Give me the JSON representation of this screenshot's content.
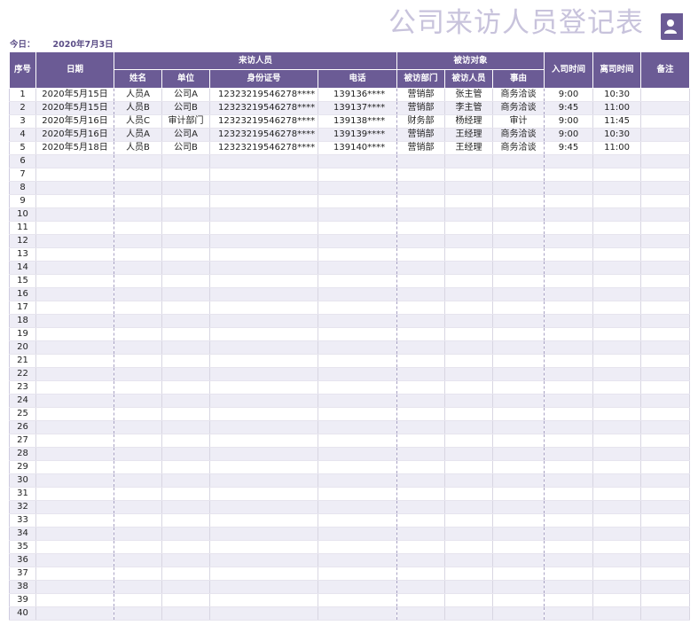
{
  "title": "公司来访人员登记表",
  "today_label": "今日：",
  "today_value": "2020年7月3日",
  "headers": {
    "seq": "序号",
    "date": "日期",
    "visitor_group": "来访人员",
    "name": "姓名",
    "unit": "单位",
    "id_no": "身份证号",
    "phone": "电话",
    "target_group": "被访对象",
    "dept": "被访部门",
    "person": "被访人员",
    "reason": "事由",
    "time_in": "入司时间",
    "time_out": "离司时间",
    "remark": "备注"
  },
  "rows": [
    [
      "1",
      "2020年5月15日",
      "人员A",
      "公司A",
      "12323219546278****",
      "139136****",
      "营销部",
      "张主管",
      "商务洽谈",
      "9:00",
      "10:30",
      ""
    ],
    [
      "2",
      "2020年5月15日",
      "人员B",
      "公司B",
      "12323219546278****",
      "139137****",
      "营销部",
      "李主管",
      "商务洽谈",
      "9:45",
      "11:00",
      ""
    ],
    [
      "3",
      "2020年5月16日",
      "人员C",
      "审计部门",
      "12323219546278****",
      "139138****",
      "财务部",
      "杨经理",
      "审计",
      "9:00",
      "11:45",
      ""
    ],
    [
      "4",
      "2020年5月16日",
      "人员A",
      "公司A",
      "12323219546278****",
      "139139****",
      "营销部",
      "王经理",
      "商务洽谈",
      "9:00",
      "10:30",
      ""
    ],
    [
      "5",
      "2020年5月18日",
      "人员B",
      "公司B",
      "12323219546278****",
      "139140****",
      "营销部",
      "王经理",
      "商务洽谈",
      "9:45",
      "11:00",
      ""
    ],
    [
      "6",
      "",
      "",
      "",
      "",
      "",
      "",
      "",
      "",
      "",
      "",
      ""
    ],
    [
      "7",
      "",
      "",
      "",
      "",
      "",
      "",
      "",
      "",
      "",
      "",
      ""
    ],
    [
      "8",
      "",
      "",
      "",
      "",
      "",
      "",
      "",
      "",
      "",
      "",
      ""
    ],
    [
      "9",
      "",
      "",
      "",
      "",
      "",
      "",
      "",
      "",
      "",
      "",
      ""
    ],
    [
      "10",
      "",
      "",
      "",
      "",
      "",
      "",
      "",
      "",
      "",
      "",
      ""
    ],
    [
      "11",
      "",
      "",
      "",
      "",
      "",
      "",
      "",
      "",
      "",
      "",
      ""
    ],
    [
      "12",
      "",
      "",
      "",
      "",
      "",
      "",
      "",
      "",
      "",
      "",
      ""
    ],
    [
      "13",
      "",
      "",
      "",
      "",
      "",
      "",
      "",
      "",
      "",
      "",
      ""
    ],
    [
      "14",
      "",
      "",
      "",
      "",
      "",
      "",
      "",
      "",
      "",
      "",
      ""
    ],
    [
      "15",
      "",
      "",
      "",
      "",
      "",
      "",
      "",
      "",
      "",
      "",
      ""
    ],
    [
      "16",
      "",
      "",
      "",
      "",
      "",
      "",
      "",
      "",
      "",
      "",
      ""
    ],
    [
      "17",
      "",
      "",
      "",
      "",
      "",
      "",
      "",
      "",
      "",
      "",
      ""
    ],
    [
      "18",
      "",
      "",
      "",
      "",
      "",
      "",
      "",
      "",
      "",
      "",
      ""
    ],
    [
      "19",
      "",
      "",
      "",
      "",
      "",
      "",
      "",
      "",
      "",
      "",
      ""
    ],
    [
      "20",
      "",
      "",
      "",
      "",
      "",
      "",
      "",
      "",
      "",
      "",
      ""
    ],
    [
      "21",
      "",
      "",
      "",
      "",
      "",
      "",
      "",
      "",
      "",
      "",
      ""
    ],
    [
      "22",
      "",
      "",
      "",
      "",
      "",
      "",
      "",
      "",
      "",
      "",
      ""
    ],
    [
      "23",
      "",
      "",
      "",
      "",
      "",
      "",
      "",
      "",
      "",
      "",
      ""
    ],
    [
      "24",
      "",
      "",
      "",
      "",
      "",
      "",
      "",
      "",
      "",
      "",
      ""
    ],
    [
      "25",
      "",
      "",
      "",
      "",
      "",
      "",
      "",
      "",
      "",
      "",
      ""
    ],
    [
      "26",
      "",
      "",
      "",
      "",
      "",
      "",
      "",
      "",
      "",
      "",
      ""
    ],
    [
      "27",
      "",
      "",
      "",
      "",
      "",
      "",
      "",
      "",
      "",
      "",
      ""
    ],
    [
      "28",
      "",
      "",
      "",
      "",
      "",
      "",
      "",
      "",
      "",
      "",
      ""
    ],
    [
      "29",
      "",
      "",
      "",
      "",
      "",
      "",
      "",
      "",
      "",
      "",
      ""
    ],
    [
      "30",
      "",
      "",
      "",
      "",
      "",
      "",
      "",
      "",
      "",
      "",
      ""
    ],
    [
      "31",
      "",
      "",
      "",
      "",
      "",
      "",
      "",
      "",
      "",
      "",
      ""
    ],
    [
      "32",
      "",
      "",
      "",
      "",
      "",
      "",
      "",
      "",
      "",
      "",
      ""
    ],
    [
      "33",
      "",
      "",
      "",
      "",
      "",
      "",
      "",
      "",
      "",
      "",
      ""
    ],
    [
      "34",
      "",
      "",
      "",
      "",
      "",
      "",
      "",
      "",
      "",
      "",
      ""
    ],
    [
      "35",
      "",
      "",
      "",
      "",
      "",
      "",
      "",
      "",
      "",
      "",
      ""
    ],
    [
      "36",
      "",
      "",
      "",
      "",
      "",
      "",
      "",
      "",
      "",
      "",
      ""
    ],
    [
      "37",
      "",
      "",
      "",
      "",
      "",
      "",
      "",
      "",
      "",
      "",
      ""
    ],
    [
      "38",
      "",
      "",
      "",
      "",
      "",
      "",
      "",
      "",
      "",
      "",
      ""
    ],
    [
      "39",
      "",
      "",
      "",
      "",
      "",
      "",
      "",
      "",
      "",
      "",
      ""
    ],
    [
      "40",
      "",
      "",
      "",
      "",
      "",
      "",
      "",
      "",
      "",
      "",
      ""
    ]
  ],
  "colors": {
    "header_bg": "#6b5b95",
    "title": "#c8c3dc",
    "alt_row": "#eeedf6"
  },
  "icons": {
    "title_icon": "person-card-icon"
  }
}
